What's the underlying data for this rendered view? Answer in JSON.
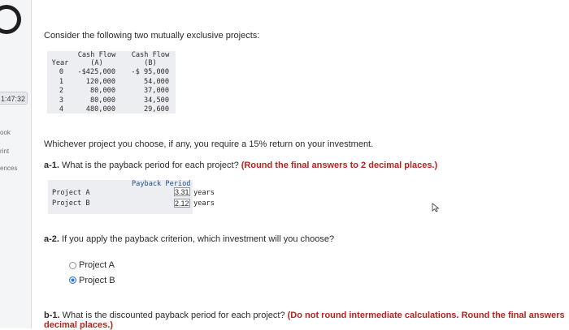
{
  "sidebar": {
    "timer": "1:47:32",
    "links": [
      "ook",
      "rint",
      "ences"
    ]
  },
  "question": {
    "intro": "Consider the following two mutually exclusive projects:",
    "table": {
      "headers": [
        [
          "Year",
          ""
        ],
        [
          "Cash Flow",
          "(A)"
        ],
        [
          "Cash Flow",
          "(B)"
        ]
      ],
      "rows": [
        [
          "0",
          "-$425,000",
          "-$ 95,000"
        ],
        [
          "1",
          "120,000",
          "54,000"
        ],
        [
          "2",
          "80,000",
          "37,000"
        ],
        [
          "3",
          "80,000",
          "34,500"
        ],
        [
          "4",
          "480,000",
          "29,600"
        ]
      ]
    },
    "return_text": "Whichever project you choose, if any, you require a 15% return on your investment.",
    "a1_prefix": "a-1.",
    "a1_text": " What is the payback period for each project? ",
    "a1_instruction": "(Round the final answers to 2 decimal places.)",
    "payback": {
      "header": "Payback Period",
      "rows": [
        {
          "label": "Project A",
          "value": "3.31",
          "unit": "years"
        },
        {
          "label": "Project B",
          "value": "2.12",
          "unit": "years"
        }
      ]
    },
    "a2_prefix": "a-2.",
    "a2_text": " If you apply the payback criterion, which investment will you choose?",
    "options": [
      {
        "label": "Project A",
        "selected": false
      },
      {
        "label": "Project B",
        "selected": true
      }
    ],
    "b1_prefix": "b-1.",
    "b1_text": " What is the discounted payback period for each project? ",
    "b1_instruction_1": "(Do not round intermediate calculations. Round the final answers",
    "b1_instruction_2": "decimal places.)"
  }
}
